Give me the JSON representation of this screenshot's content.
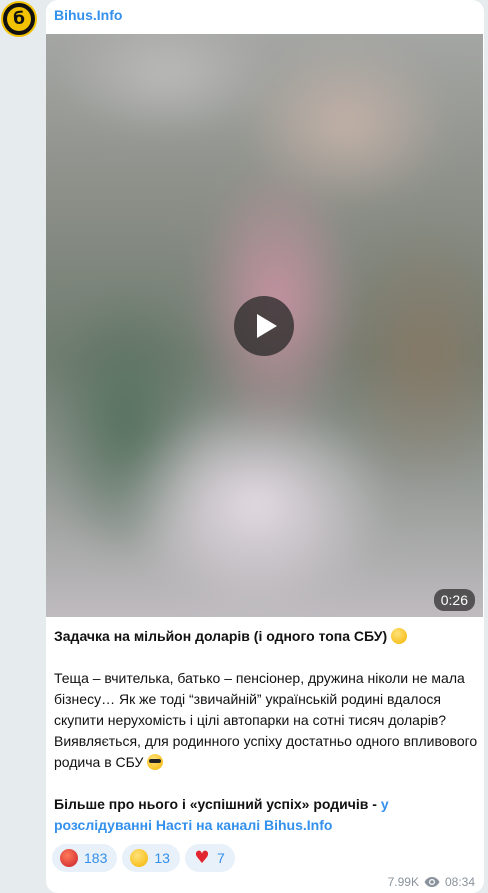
{
  "channel": {
    "name": "Bihus.Info",
    "avatar_letter": "б"
  },
  "video": {
    "duration": "0:26"
  },
  "post": {
    "title": "Задачка на мільйон доларів (і одного топа СБУ)",
    "paragraph": "Теща – вчителька, батько – пенсіонер, дружина ніколи не мала бізнесу… Як же тоді “звичайній” українській родині вдалося скупити нерухомість і цілі автопарки на сотні тисяч доларів? Виявляється, для родинного успіху достатньо одного впливового родича в СБУ",
    "more_prefix": "Більше про нього і «успішний успіх» родичів -",
    "more_link": "у розслідуванні Насті на каналі Bihus.Info"
  },
  "reactions": [
    {
      "emoji": "angry-face",
      "count": "183"
    },
    {
      "emoji": "grinning-face",
      "count": "13"
    },
    {
      "emoji": "red-heart",
      "count": "7"
    }
  ],
  "meta": {
    "views": "7.99K",
    "time": "08:34"
  },
  "colors": {
    "background": "#e6ebee",
    "accent": "#3390ec",
    "brand_yellow": "#f2c200"
  }
}
